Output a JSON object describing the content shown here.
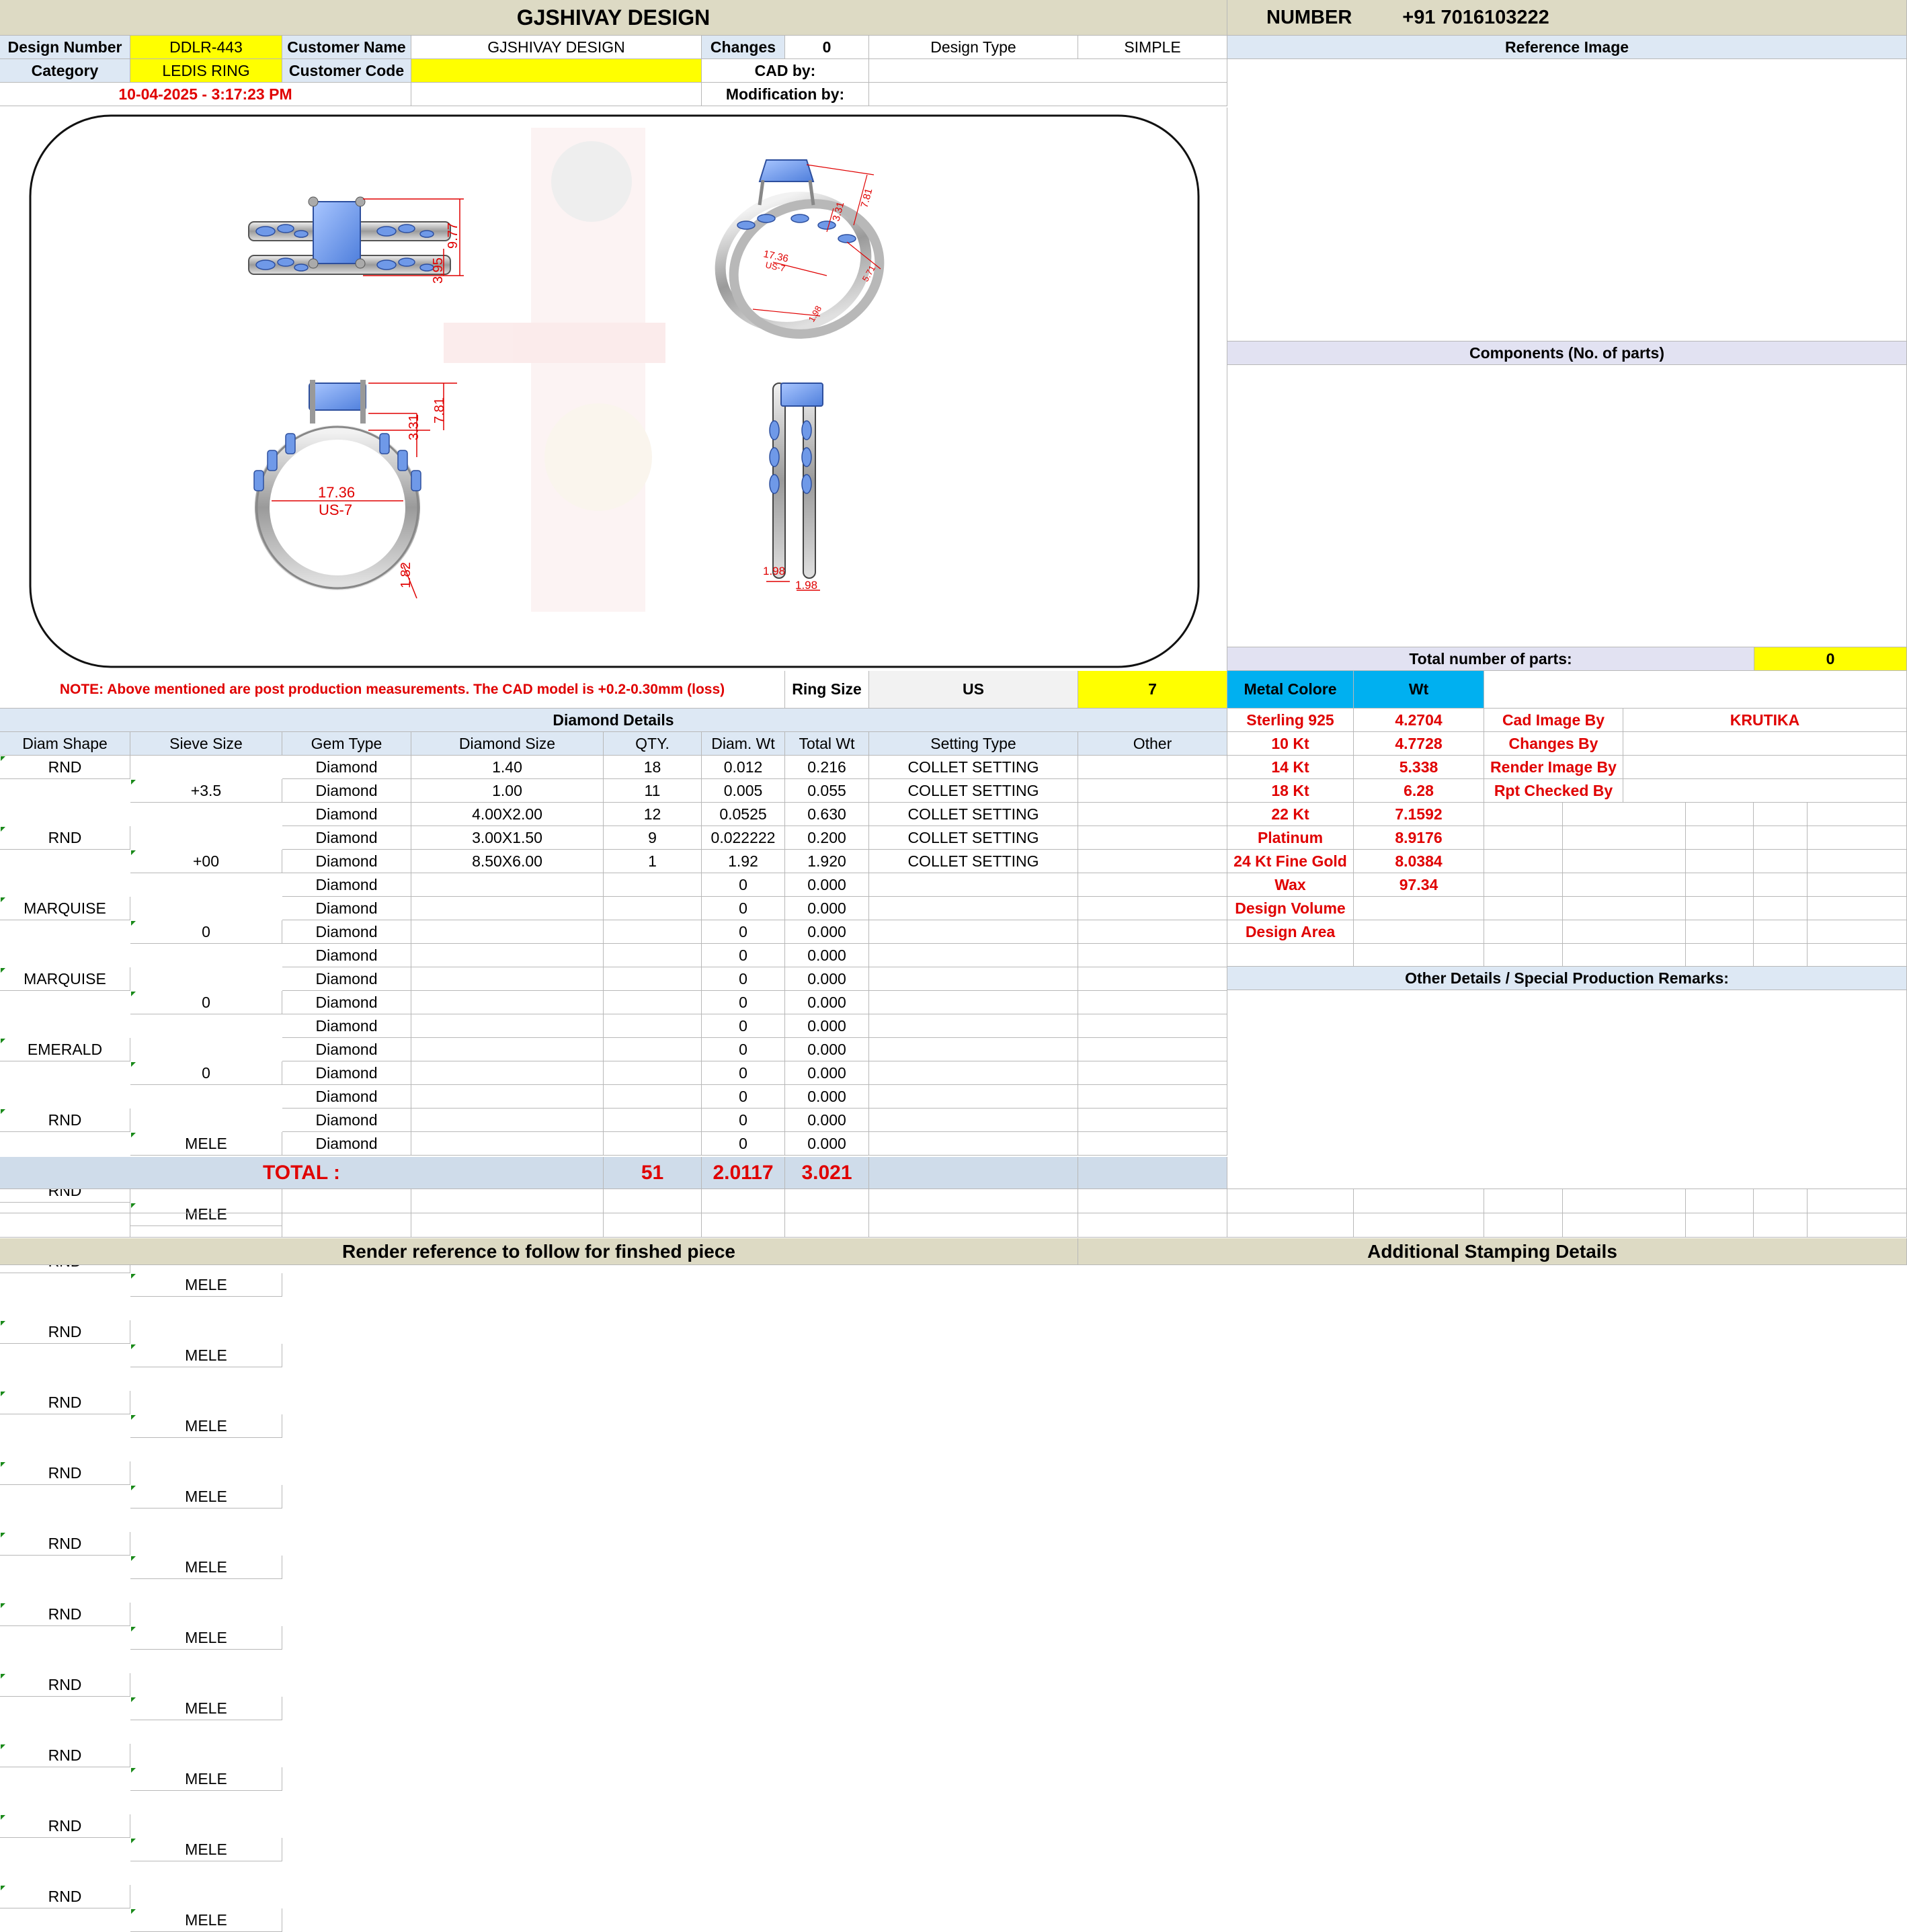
{
  "company": "GJSHIVAY DESIGN",
  "number_label": "NUMBER",
  "number_value": "+91 7016103222",
  "design_number_label": "Design Number",
  "design_number": "DDLR-443",
  "customer_name_label": "Customer Name",
  "customer_name": "GJSHIVAY DESIGN",
  "changes_label": "Changes",
  "changes": "0",
  "design_type_label": "Design Type",
  "design_type": "SIMPLE",
  "reference_image_label": "Reference Image",
  "category_label": "Category",
  "category": "LEDIS RING",
  "customer_code_label": "Customer Code",
  "customer_code": "",
  "cad_by_label": "CAD by:",
  "cad_by": "",
  "date": "10-04-2025 - 3:17:23 PM",
  "modification_by_label": "Modification by:",
  "modification_by": "",
  "drawing": {
    "top_dim1": "9.77",
    "top_dim2": "3.95",
    "persp_dim1": "7.81",
    "persp_dim2": "3.31",
    "persp_dim3": "17.36",
    "persp_dim4": "US-7",
    "persp_dim5": "1.98",
    "persp_dim6": "5.71",
    "front_dim1": "7.81",
    "front_dim2": "3.31",
    "front_size": "17.36",
    "front_us": "US-7",
    "front_dim3": "1.82",
    "side_dim1": "1.98",
    "side_dim2": "1.98"
  },
  "components_label": "Components (No. of parts)",
  "total_parts_label": "Total number of parts:",
  "total_parts": "0",
  "note": "NOTE: Above mentioned are post production measurements. The CAD model is +0.2-0.30mm (loss)",
  "ring_size_label": "Ring Size",
  "ring_size_unit": "US",
  "ring_size": "7",
  "metal_colore_label": "Metal Colore",
  "wt_label": "Wt",
  "diamond_details_label": "Diamond Details",
  "columns": [
    "Diam Shape",
    "Sieve Size",
    "Gem Type",
    "Diamond Size",
    "QTY.",
    "Diam. Wt",
    "Total Wt",
    "Setting Type",
    "Other"
  ],
  "diamond_rows": [
    [
      "RND",
      "+3.5",
      "Diamond",
      "1.40",
      "18",
      "0.012",
      "0.216",
      "COLLET SETTING",
      ""
    ],
    [
      "RND",
      "+00",
      "Diamond",
      "1.00",
      "11",
      "0.005",
      "0.055",
      "COLLET SETTING",
      ""
    ],
    [
      "MARQUISE",
      "0",
      "Diamond",
      "4.00X2.00",
      "12",
      "0.0525",
      "0.630",
      "COLLET SETTING",
      ""
    ],
    [
      "MARQUISE",
      "0",
      "Diamond",
      "3.00X1.50",
      "9",
      "0.022222",
      "0.200",
      "COLLET SETTING",
      ""
    ],
    [
      "EMERALD",
      "0",
      "Diamond",
      "8.50X6.00",
      "1",
      "1.92",
      "1.920",
      "COLLET SETTING",
      ""
    ],
    [
      "RND",
      "MELE",
      "Diamond",
      "",
      "",
      "0",
      "0.000",
      "",
      ""
    ],
    [
      "RND",
      "MELE",
      "Diamond",
      "",
      "",
      "0",
      "0.000",
      "",
      ""
    ],
    [
      "RND",
      "MELE",
      "Diamond",
      "",
      "",
      "0",
      "0.000",
      "",
      ""
    ],
    [
      "RND",
      "MELE",
      "Diamond",
      "",
      "",
      "0",
      "0.000",
      "",
      ""
    ],
    [
      "RND",
      "MELE",
      "Diamond",
      "",
      "",
      "0",
      "0.000",
      "",
      ""
    ],
    [
      "RND",
      "MELE",
      "Diamond",
      "",
      "",
      "0",
      "0.000",
      "",
      ""
    ],
    [
      "RND",
      "MELE",
      "Diamond",
      "",
      "",
      "0",
      "0.000",
      "",
      ""
    ],
    [
      "RND",
      "MELE",
      "Diamond",
      "",
      "",
      "0",
      "0.000",
      "",
      ""
    ],
    [
      "RND",
      "MELE",
      "Diamond",
      "",
      "",
      "0",
      "0.000",
      "",
      ""
    ],
    [
      "RND",
      "MELE",
      "Diamond",
      "",
      "",
      "0",
      "0.000",
      "",
      ""
    ],
    [
      "RND",
      "MELE",
      "Diamond",
      "",
      "",
      "0",
      "0.000",
      "",
      ""
    ],
    [
      "RND",
      "MELE",
      "Diamond",
      "",
      "",
      "0",
      "0.000",
      "",
      ""
    ]
  ],
  "total_label": "TOTAL :",
  "total_qty": "51",
  "total_diam_wt": "2.0117",
  "total_wt": "3.021",
  "metals": [
    [
      "Sterling 925",
      "4.2704"
    ],
    [
      "10 Kt",
      "4.7728"
    ],
    [
      "14 Kt",
      "5.338"
    ],
    [
      "18 Kt",
      "6.28"
    ],
    [
      "22 Kt",
      "7.1592"
    ],
    [
      "Platinum",
      "8.9176"
    ],
    [
      "24 Kt Fine Gold",
      "8.0384"
    ],
    [
      "Wax",
      "97.34"
    ],
    [
      "Design Volume",
      ""
    ],
    [
      "Design Area",
      ""
    ]
  ],
  "credits": [
    [
      "Cad Image By",
      "KRUTIKA"
    ],
    [
      "Changes By",
      ""
    ],
    [
      "Render Image By",
      ""
    ],
    [
      "Rpt Checked By",
      ""
    ]
  ],
  "other_details_label": "Other Details / Special Production Remarks:",
  "render_reference_label": "Render reference to follow for finshed piece",
  "additional_stamping_label": "Additional Stamping Details"
}
